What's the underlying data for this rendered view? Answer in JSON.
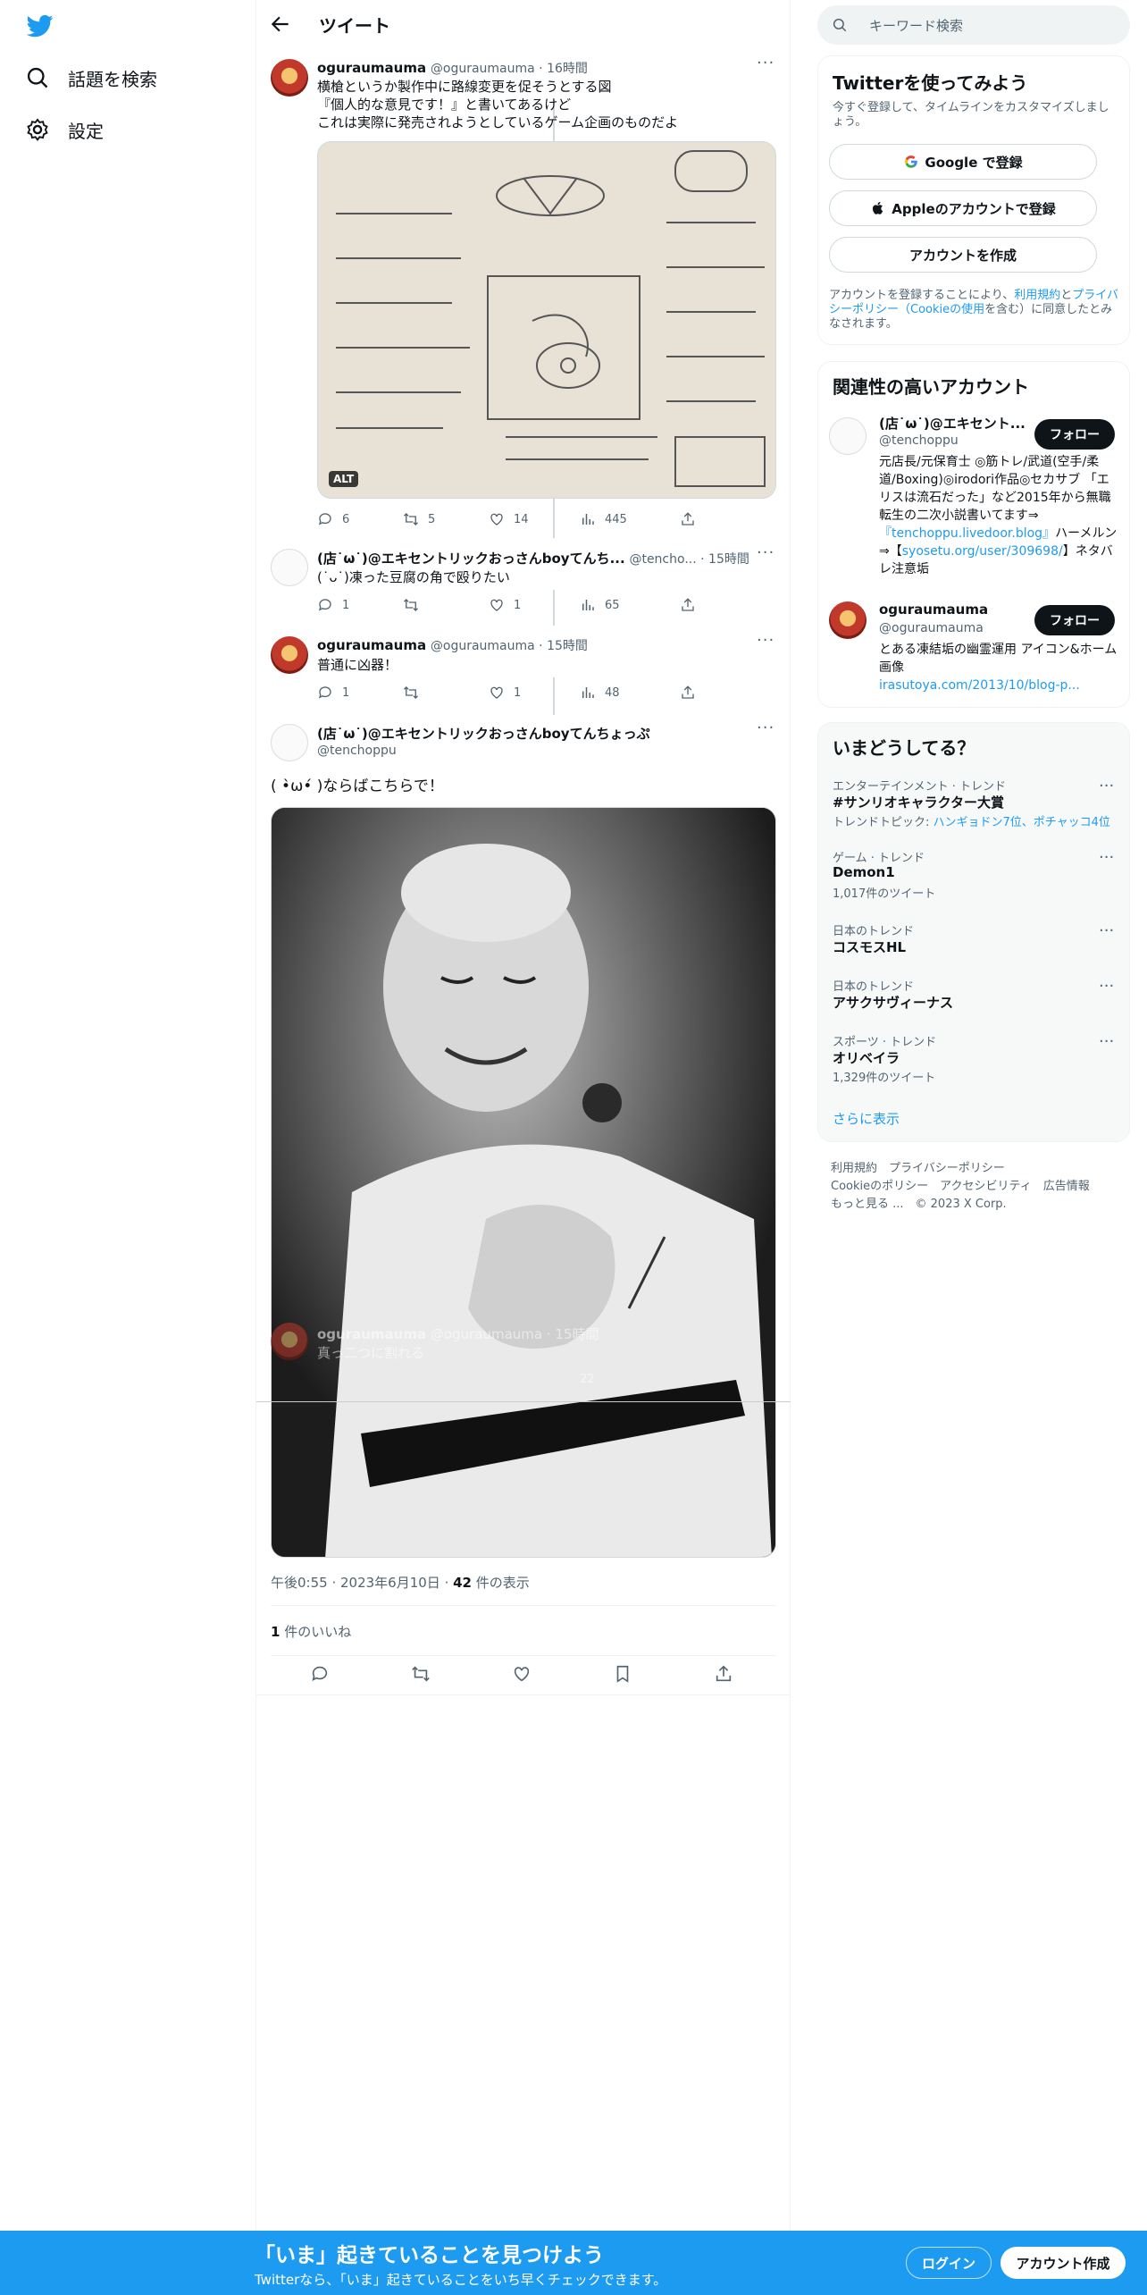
{
  "nav": {
    "search_label": "話題を検索",
    "settings_label": "設定"
  },
  "header": {
    "title": "ツイート"
  },
  "tweets": [
    {
      "name": "oguraumauma",
      "handle": "@oguraumauma",
      "time": "16時間",
      "text": [
        "横槍というか製作中に路線変更を促そうとする図",
        "『個人的な意見です！』と書いてあるけど",
        "これは実際に発売されようとしているゲーム企画のものだよ"
      ],
      "alt": "ALT",
      "replies": "6",
      "retweets": "5",
      "likes": "14",
      "views": "445"
    },
    {
      "name": "(店˙ω˙)@エキセントリックおっさんboyてんち...",
      "handle": "@tencho...",
      "time": "15時間",
      "text": [
        "(˙ᴗ˙)凍った豆腐の角で殴りたい"
      ],
      "replies": "1",
      "retweets": "",
      "likes": "1",
      "views": "65"
    },
    {
      "name": "oguraumauma",
      "handle": "@oguraumauma",
      "time": "15時間",
      "text": [
        "普通に凶器！"
      ],
      "replies": "1",
      "retweets": "",
      "likes": "1",
      "views": "48"
    },
    {
      "name": "oguraumauma",
      "handle": "@oguraumauma",
      "time": "15時間",
      "text": [
        "真っ二つに割れる"
      ],
      "replies": "",
      "retweets": "",
      "likes": "",
      "views": "22"
    }
  ],
  "focus": {
    "name": "(店˙ω˙)@エキセントリックおっさんboyてんちょっぷ",
    "handle": "@tenchoppu",
    "text": "( •̀ω•́ )ならばこちらで！",
    "time": "午後0:55",
    "date": "2023年6月10日",
    "views_count": "42",
    "views_label": " 件の表示",
    "likes_count": "1",
    "likes_label": " 件のいいね"
  },
  "right": {
    "search_placeholder": "キーワード検索",
    "signup": {
      "title": "Twitterを使ってみよう",
      "sub": "今すぐ登録して、タイムラインをカスタマイズしましょう。",
      "google": "Google で登録",
      "apple": "Appleのアカウントで登録",
      "create": "アカウントを作成",
      "terms_pre": "アカウントを登録することにより、",
      "terms_link1": "利用規約",
      "terms_mid": "と",
      "terms_link2": "プライバシーポリシー（Cookieの使用",
      "terms_post": "を含む）に同意したとみなされます。"
    },
    "related": {
      "title": "関連性の高いアカウント",
      "follow": "フォロー",
      "accounts": [
        {
          "name": "(店˙ω˙)@エキセント...",
          "handle": "@tenchoppu",
          "bio1": "元店長/元保育士 ◎筋トレ/武道(空手/柔道/Boxing)◎irodori作品◎セカサブ 「エリスは流石だった」など2015年から無職転生の二次小説書いてます⇒",
          "link1": "『tenchoppu.livedoor.blog』",
          "bio2": "ハーメルン⇒【",
          "link2": "syosetu.org/user/309698/",
          "bio3": "】ネタバレ注意垢"
        },
        {
          "name": "oguraumauma",
          "handle": "@oguraumauma",
          "bio1": "とある凍結垢の幽霊運用 アイコン&ホーム画像",
          "link1": "irasutoya.com/2013/10/blog-p..."
        }
      ]
    },
    "trends": {
      "title": "いまどうしてる？",
      "more": "さらに表示",
      "items": [
        {
          "cat": "エンターテインメント · トレンド",
          "name": "#サンリオキャラクター大賞",
          "sub_pre": "トレンドトピック: ",
          "sub_link": "ハンギョドン7位、ポチャッコ4位"
        },
        {
          "cat": "ゲーム · トレンド",
          "name": "Demon1",
          "sub": "1,017件のツイート"
        },
        {
          "cat": "日本のトレンド",
          "name": "コスモスHL"
        },
        {
          "cat": "日本のトレンド",
          "name": "アサクサヴィーナス"
        },
        {
          "cat": "スポーツ · トレンド",
          "name": "オリベイラ",
          "sub": "1,329件のツイート"
        }
      ]
    },
    "footer": {
      "l1": "利用規約　プライバシーポリシー",
      "l2": "Cookieのポリシー　アクセシビリティ　広告情報",
      "l3": "もっと見る ...　© 2023 X Corp."
    }
  },
  "bottom": {
    "title": "「いま」起きていることを見つけよう",
    "sub": "Twitterなら、「いま」起きていることをいち早くチェックできます。",
    "login": "ログイン",
    "signup": "アカウント作成"
  },
  "colors": {
    "accent": "#1d9bf0",
    "text": "#0f1419",
    "muted": "#536471"
  }
}
